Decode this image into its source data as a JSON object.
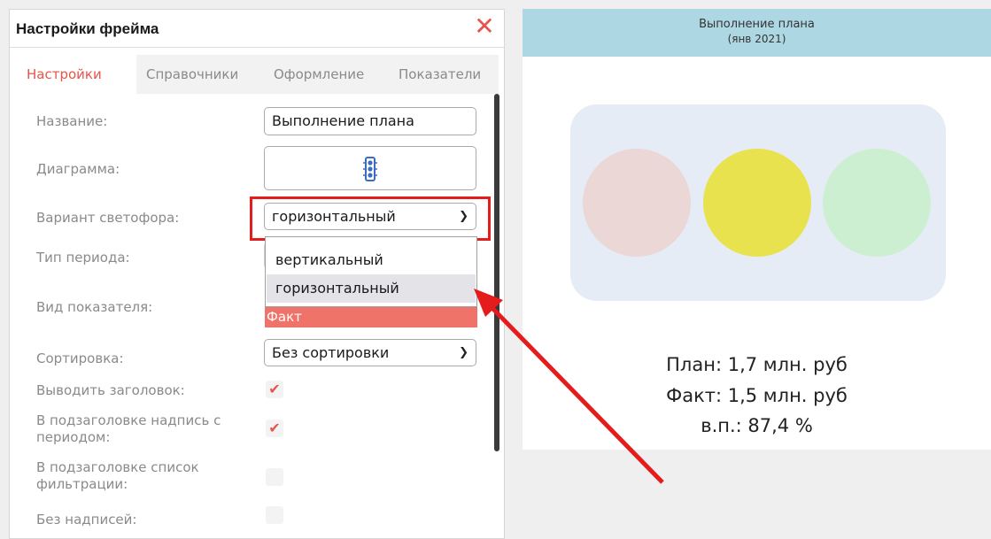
{
  "panel": {
    "title": "Настройки фрейма",
    "close_symbol": "✕",
    "tabs": [
      "Настройки",
      "Справочники",
      "Оформление",
      "Показатели"
    ]
  },
  "form": {
    "name_label": "Название:",
    "name_value": "Выполнение плана",
    "diagram_label": "Диаграмма:",
    "diagram_icon": "traffic-light-icon",
    "variant_label": "Вариант светофора:",
    "variant_value": "горизонтальный",
    "variant_options": [
      "вертикальный",
      "горизонтальный"
    ],
    "period_label": "Тип периода:",
    "indicator_label": "Вид показателя:",
    "indicator_value": "Факт",
    "sort_label": "Сортировка:",
    "sort_value": "Без сортировки",
    "show_title_label": "Выводить заголовок:",
    "show_title_checked": true,
    "subtitle_period_label": "В подзаголовке надпись с периодом:",
    "subtitle_period_checked": true,
    "subtitle_filter_label": "В подзаголовке список фильтрации:",
    "subtitle_filter_checked": false,
    "no_labels_label": "Без надписей:",
    "no_labels_checked": false
  },
  "preview": {
    "title": "Выполнение плана",
    "subtitle": "(янв 2021)",
    "lights": [
      "#ead7d6",
      "#e9e24f",
      "#cdefd1"
    ],
    "plan": "План: 1,7 млн. руб",
    "fact": "Факт: 1,5 млн. руб",
    "completion": "в.п.: 87,4 %"
  },
  "colors": {
    "accent": "#e8534a",
    "header_bg": "#aed7e4",
    "annotation": "#e51c1c"
  }
}
